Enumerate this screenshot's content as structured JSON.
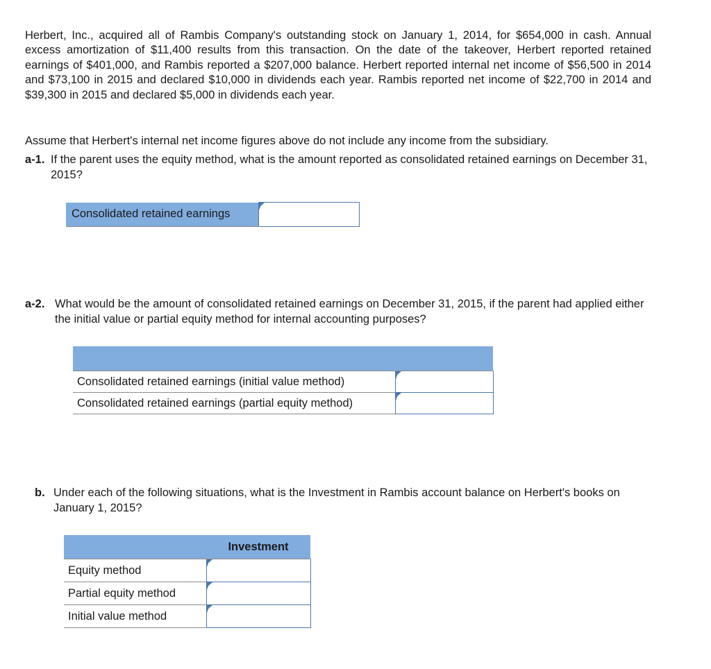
{
  "document": {
    "intro_paragraph": "Herbert, Inc., acquired all of Rambis Company's outstanding stock on January 1, 2014, for $654,000 in cash. Annual excess amortization of $11,400 results from this transaction. On the date of the takeover, Herbert reported retained earnings of $401,000, and Rambis reported a $207,000 balance. Herbert reported internal net income of $56,500 in 2014 and $73,100 in 2015 and declared $10,000 in dividends each year. Rambis reported net income of $22,700 in 2014 and $39,300 in 2015 and declared $5,000 in dividends each year.",
    "assumption": "Assume that Herbert's internal net income figures above do not include any income from the subsidiary."
  },
  "questions": {
    "a1": {
      "label": "a-1.",
      "text": "If the parent uses the equity method, what is the amount reported as consolidated retained earnings on December 31, 2015?"
    },
    "a2": {
      "label": "a-2.",
      "text": "What would be the amount of consolidated retained earnings on December 31, 2015, if the parent had applied either the initial value or partial equity method for internal accounting purposes?"
    },
    "b": {
      "label": "b.",
      "text": "Under each of the following situations, what is the Investment in Rambis account balance on Herbert's books on January 1, 2015?"
    }
  },
  "table_a1": {
    "row_label": "Consolidated retained earnings",
    "input_value": "",
    "input_placeholder": ""
  },
  "table_a2": {
    "header_label": "",
    "rows": [
      {
        "label": "Consolidated retained earnings (initial value method)",
        "value": "",
        "placeholder": ""
      },
      {
        "label": "Consolidated retained earnings (partial equity method)",
        "value": "",
        "placeholder": ""
      }
    ]
  },
  "table_b": {
    "header_blank": "",
    "header_column": "Investment",
    "rows": [
      {
        "label": "Equity method",
        "value": "",
        "placeholder": ""
      },
      {
        "label": "Partial equity method",
        "value": "",
        "placeholder": ""
      },
      {
        "label": "Initial value method",
        "value": "",
        "placeholder": ""
      }
    ]
  },
  "colors": {
    "header_blue": "#81ACDE",
    "input_border_blue": "#4a77b0",
    "row_border_gray": "#8c8c8c",
    "text": "#1a1a1a",
    "background": "#ffffff"
  }
}
